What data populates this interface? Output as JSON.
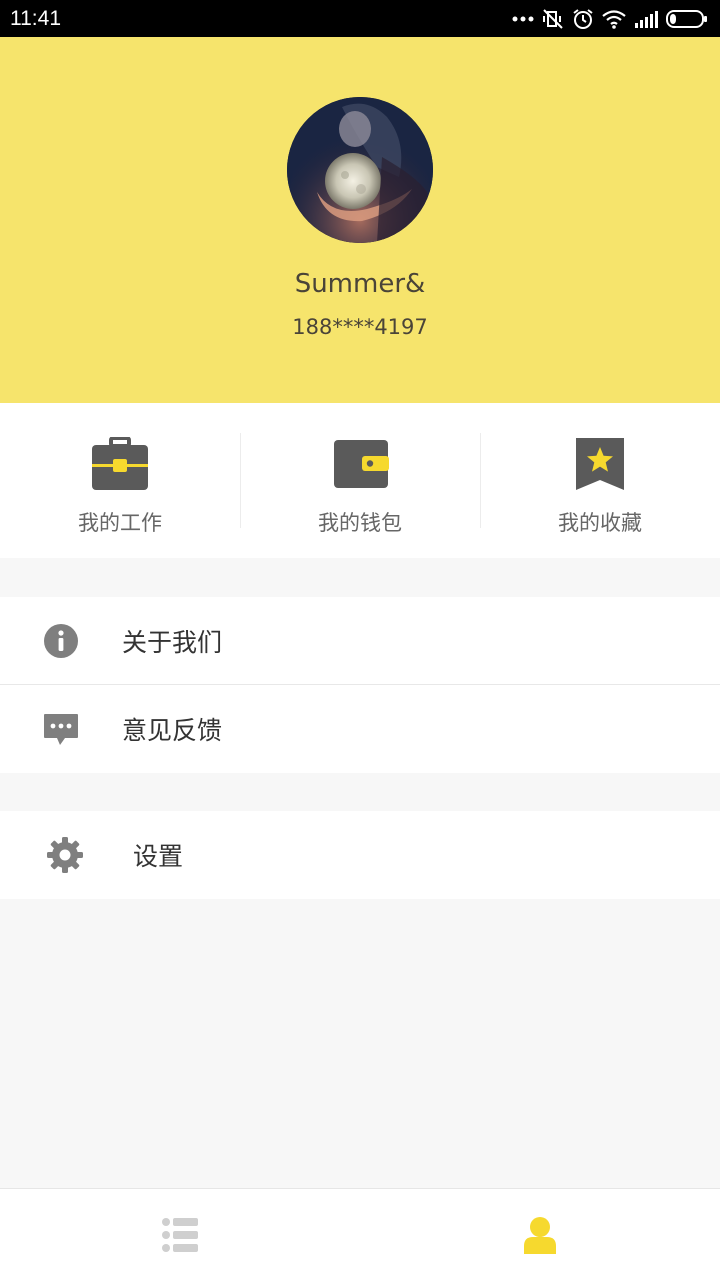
{
  "status_bar": {
    "time": "11:41"
  },
  "profile": {
    "name": "Summer&",
    "phone": "188****4197"
  },
  "quick_actions": [
    {
      "label": "我的工作",
      "icon": "briefcase-icon"
    },
    {
      "label": "我的钱包",
      "icon": "wallet-icon"
    },
    {
      "label": "我的收藏",
      "icon": "bookmark-star-icon"
    }
  ],
  "menu": {
    "about": {
      "label": "关于我们",
      "icon": "info-icon"
    },
    "feedback": {
      "label": "意见反馈",
      "icon": "message-icon"
    },
    "settings": {
      "label": "设置",
      "icon": "gear-icon"
    }
  },
  "bottom_nav": [
    {
      "icon": "list-icon",
      "active": false
    },
    {
      "icon": "user-icon",
      "active": true
    }
  ],
  "colors": {
    "header_bg": "#f6e46c",
    "accent": "#f6d92e",
    "icon_gray": "#5a5a5a",
    "page_bg": "#f7f7f7"
  }
}
